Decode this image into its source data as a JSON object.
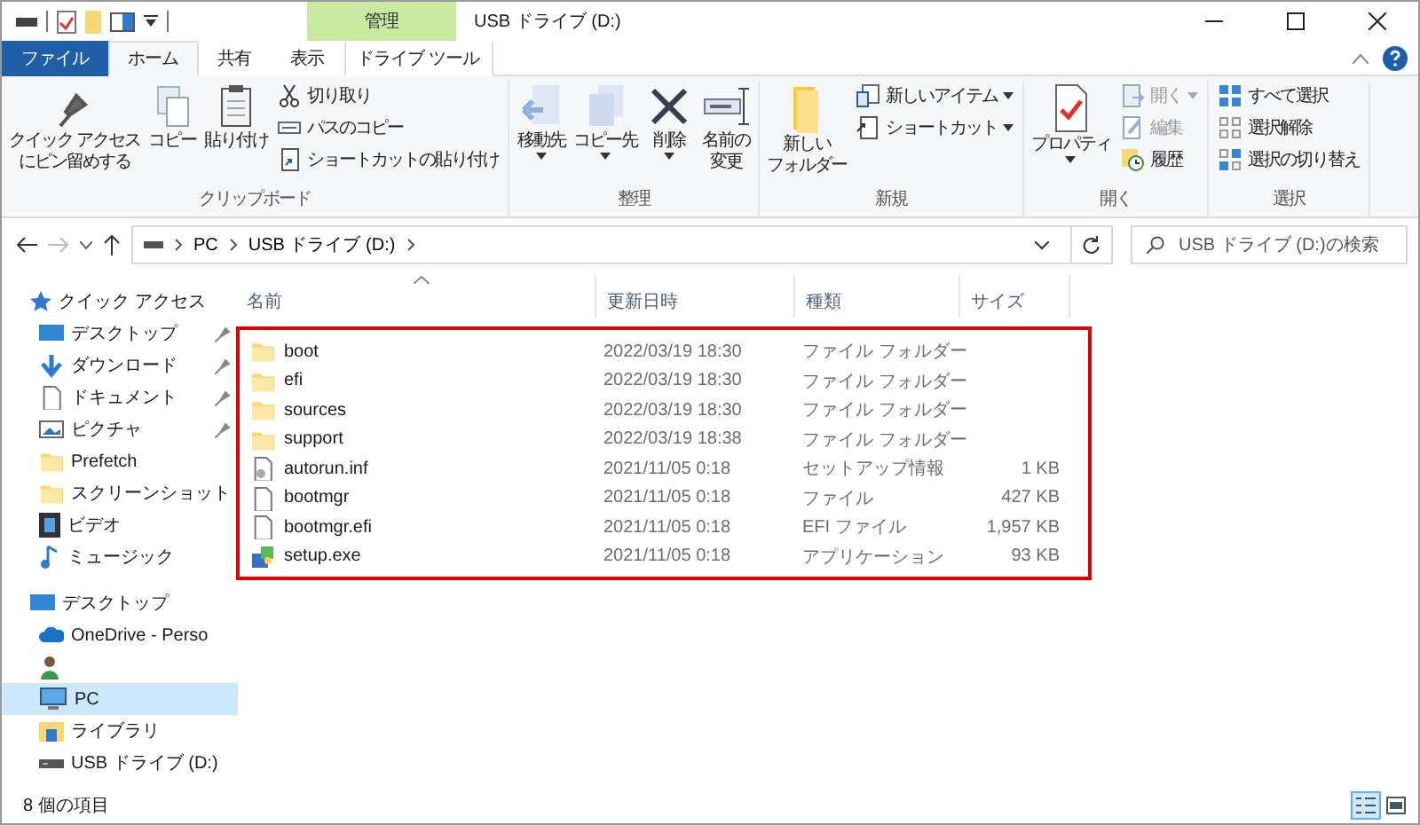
{
  "window": {
    "title": "USB ドライブ (D:)",
    "context_tab_header": "管理"
  },
  "tabs": [
    {
      "label": "ファイル",
      "kind": "file",
      "selected": false
    },
    {
      "label": "ホーム",
      "kind": "normal",
      "selected": true
    },
    {
      "label": "共有",
      "kind": "normal",
      "selected": false
    },
    {
      "label": "表示",
      "kind": "normal",
      "selected": false
    },
    {
      "label": "ドライブ ツール",
      "kind": "context",
      "selected": false
    }
  ],
  "ribbon": [
    {
      "label": "クリップボード",
      "items": [
        {
          "kind": "large",
          "lines": [
            "クイック アクセス",
            "にピン留めする"
          ],
          "disabled": false,
          "dropdown": false
        },
        {
          "kind": "large",
          "lines": [
            "コピー"
          ],
          "disabled": false,
          "dropdown": false
        },
        {
          "kind": "large",
          "lines": [
            "貼り付け"
          ],
          "disabled": false,
          "dropdown": false
        },
        {
          "kind": "small",
          "label": "切り取り",
          "disabled": false,
          "dropdown": false
        },
        {
          "kind": "small",
          "label": "パスのコピー",
          "disabled": false,
          "dropdown": false
        },
        {
          "kind": "small",
          "label": "ショートカットの貼り付け",
          "disabled": false,
          "dropdown": false
        }
      ]
    },
    {
      "label": "整理",
      "items": [
        {
          "kind": "large",
          "lines": [
            "移動先"
          ],
          "disabled": false,
          "dropdown": true
        },
        {
          "kind": "large",
          "lines": [
            "コピー先"
          ],
          "disabled": false,
          "dropdown": true
        },
        {
          "kind": "large",
          "lines": [
            "削除"
          ],
          "disabled": false,
          "dropdown": true
        },
        {
          "kind": "large",
          "lines": [
            "名前の",
            "変更"
          ],
          "disabled": false,
          "dropdown": false
        }
      ]
    },
    {
      "label": "新規",
      "items": [
        {
          "kind": "large",
          "lines": [
            "新しい",
            "フォルダー"
          ],
          "disabled": false,
          "dropdown": false
        },
        {
          "kind": "small",
          "label": "新しいアイテム",
          "disabled": false,
          "dropdown": true
        },
        {
          "kind": "small",
          "label": "ショートカット",
          "disabled": false,
          "dropdown": true
        }
      ]
    },
    {
      "label": "開く",
      "items": [
        {
          "kind": "large",
          "lines": [
            "プロパティ"
          ],
          "disabled": false,
          "dropdown": true
        },
        {
          "kind": "small",
          "label": "開く",
          "disabled": true,
          "dropdown": true
        },
        {
          "kind": "small",
          "label": "編集",
          "disabled": true,
          "dropdown": false
        },
        {
          "kind": "small",
          "label": "履歴",
          "disabled": false,
          "dropdown": false
        }
      ]
    },
    {
      "label": "選択",
      "items": [
        {
          "kind": "small",
          "label": "すべて選択",
          "disabled": false,
          "dropdown": false
        },
        {
          "kind": "small",
          "label": "選択解除",
          "disabled": false,
          "dropdown": false
        },
        {
          "kind": "small",
          "label": "選択の切り替え",
          "disabled": false,
          "dropdown": false
        }
      ]
    }
  ],
  "address_bar": {
    "path": [
      "PC",
      "USB ドライブ (D:)"
    ]
  },
  "search": {
    "placeholder": "USB ドライブ (D:)の検索"
  },
  "sidebar": {
    "items": [
      {
        "label": "クイック アクセス",
        "kind": "star",
        "selected": false,
        "children": [
          {
            "label": "デスクトップ",
            "kind": "desktop",
            "selected": false,
            "pinned": true
          },
          {
            "label": "ダウンロード",
            "kind": "download",
            "selected": false,
            "pinned": true
          },
          {
            "label": "ドキュメント",
            "kind": "document",
            "selected": false,
            "pinned": true
          },
          {
            "label": "ピクチャ",
            "kind": "picture",
            "selected": false,
            "pinned": true
          },
          {
            "label": "Prefetch",
            "kind": "folder",
            "selected": false,
            "pinned": false
          },
          {
            "label": "スクリーンショット",
            "kind": "folder",
            "selected": false,
            "pinned": false
          },
          {
            "label": "ビデオ",
            "kind": "video",
            "selected": false,
            "pinned": false
          },
          {
            "label": "ミュージック",
            "kind": "music",
            "selected": false,
            "pinned": false
          }
        ]
      },
      {
        "label": "デスクトップ",
        "kind": "desktop",
        "selected": false,
        "children": [
          {
            "label": "OneDrive - Perso",
            "kind": "cloud",
            "selected": false,
            "pinned": false
          },
          {
            "kind": "user",
            "selected": false,
            "pinned": false
          },
          {
            "label": "PC",
            "kind": "pc",
            "selected": true,
            "pinned": false
          },
          {
            "label": "ライブラリ",
            "kind": "library",
            "selected": false,
            "pinned": false
          },
          {
            "label": "USB ドライブ (D:)",
            "kind": "drive",
            "selected": false,
            "pinned": false
          }
        ]
      }
    ]
  },
  "table": {
    "columns": [
      "名前",
      "更新日時",
      "種類",
      "サイズ"
    ],
    "rows": [
      {
        "kind": "folder",
        "name": "boot",
        "modified": "2022/03/19 18:30",
        "type": "ファイル フォルダー",
        "selected": false
      },
      {
        "kind": "folder",
        "name": "efi",
        "modified": "2022/03/19 18:30",
        "type": "ファイル フォルダー",
        "selected": false
      },
      {
        "kind": "folder",
        "name": "sources",
        "modified": "2022/03/19 18:30",
        "type": "ファイル フォルダー",
        "selected": false
      },
      {
        "kind": "folder",
        "name": "support",
        "modified": "2022/03/19 18:38",
        "type": "ファイル フォルダー",
        "selected": false
      },
      {
        "kind": "setup-info",
        "name": "autorun.inf",
        "modified": "2021/11/05 0:18",
        "type": "セットアップ情報",
        "size": "1 KB",
        "selected": false
      },
      {
        "kind": "file",
        "name": "bootmgr",
        "modified": "2021/11/05 0:18",
        "type": "ファイル",
        "size": "427 KB",
        "selected": false
      },
      {
        "kind": "file",
        "name": "bootmgr.efi",
        "modified": "2021/11/05 0:18",
        "type": "EFI ファイル",
        "size": "1,957 KB",
        "selected": false
      },
      {
        "kind": "app",
        "name": "setup.exe",
        "modified": "2021/11/05 0:18",
        "type": "アプリケーション",
        "size": "93 KB",
        "selected": false
      }
    ]
  },
  "status_bar": {
    "count": "8 個の項目",
    "views": [
      {
        "kind": "details",
        "selected": true
      },
      {
        "kind": "thumbnails",
        "selected": false
      }
    ]
  }
}
